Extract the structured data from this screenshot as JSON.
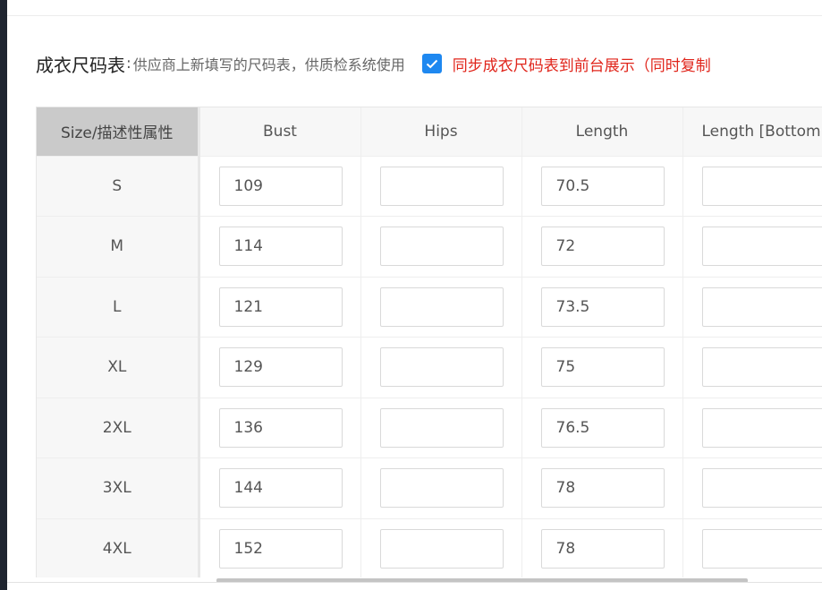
{
  "header": {
    "title": "成衣尺码表",
    "subtitle": "供应商上新填写的尺码表，供质检系统使用",
    "sync_checked": true,
    "sync_label": "同步成衣尺码表到前台展示（同时复制"
  },
  "table": {
    "size_header": "Size/描述性属性",
    "columns": [
      "Bust",
      "Hips",
      "Length",
      "Length [Bottom]"
    ],
    "rows": [
      {
        "size": "S",
        "values": [
          "109",
          "",
          "70.5",
          ""
        ]
      },
      {
        "size": "M",
        "values": [
          "114",
          "",
          "72",
          ""
        ]
      },
      {
        "size": "L",
        "values": [
          "121",
          "",
          "73.5",
          ""
        ]
      },
      {
        "size": "XL",
        "values": [
          "129",
          "",
          "75",
          ""
        ]
      },
      {
        "size": "2XL",
        "values": [
          "136",
          "",
          "76.5",
          ""
        ]
      },
      {
        "size": "3XL",
        "values": [
          "144",
          "",
          "78",
          ""
        ]
      },
      {
        "size": "4XL",
        "values": [
          "152",
          "",
          "78",
          ""
        ]
      }
    ]
  },
  "colors": {
    "accent": "#1e88f0",
    "warning_text": "#e0251b"
  }
}
